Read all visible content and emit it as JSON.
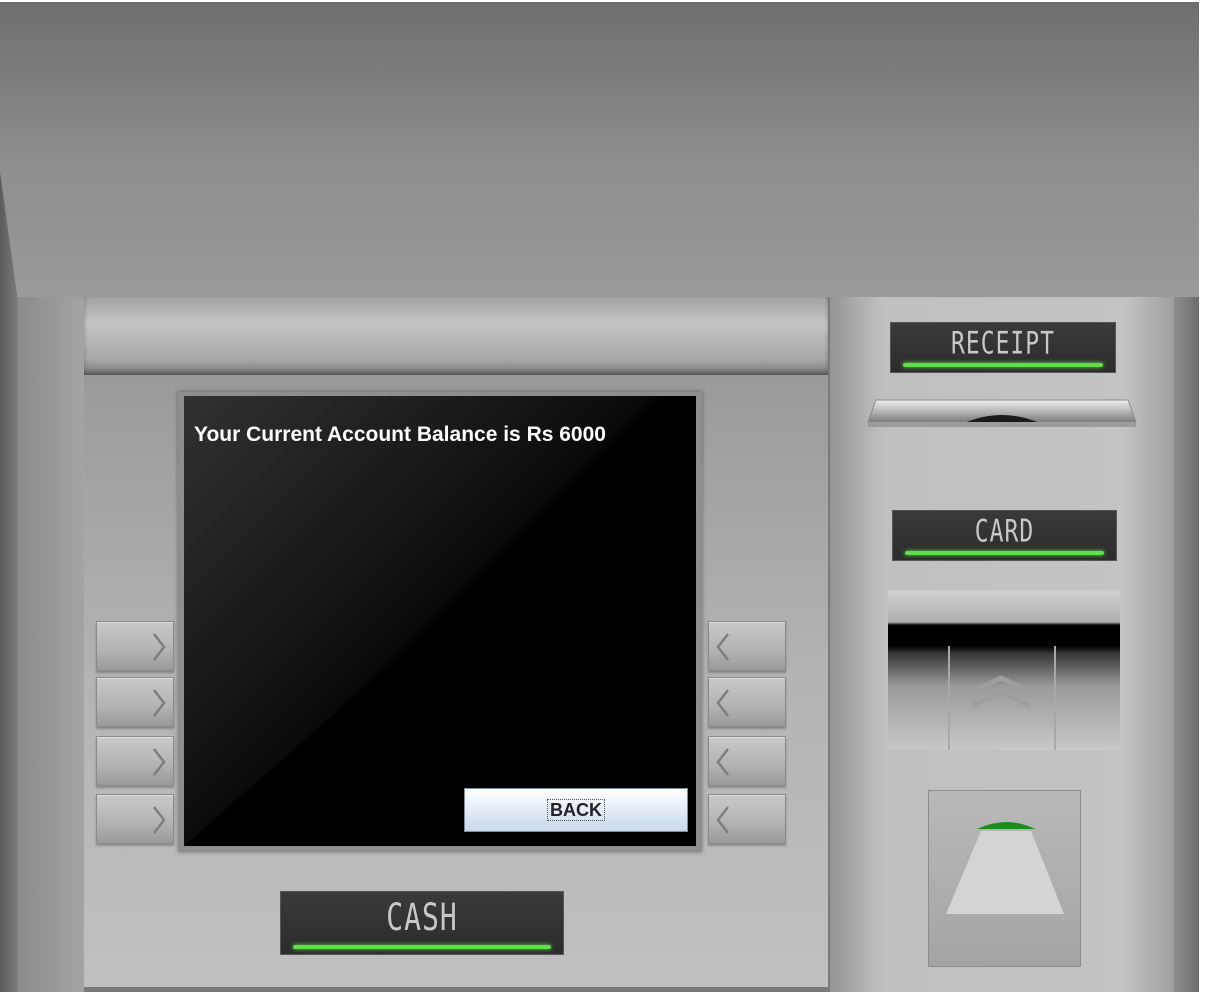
{
  "screen": {
    "message": "Your Current Account Balance is Rs 6000",
    "back_button_label": "BACK"
  },
  "labels": {
    "receipt": "RECEIPT",
    "card": "CARD",
    "cash": "CASH"
  },
  "colors": {
    "screen_background": "#000000",
    "screen_text": "#ffffff",
    "led_indicator": "#5fe04a",
    "panel_gray": "#b4b4b4"
  },
  "icons": {
    "left_keys": "chevron-right-icon",
    "right_keys": "chevron-left-icon",
    "card_slot": "double-chevron-up-icon",
    "cash_indicator": "cash-tray-icon"
  }
}
